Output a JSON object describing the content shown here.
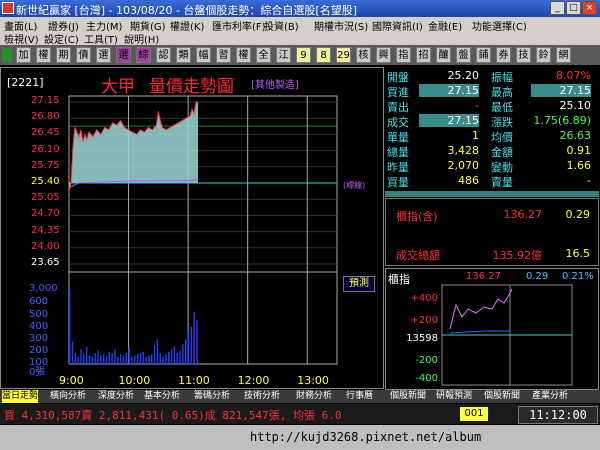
{
  "window": {
    "title": "新世紀贏家 [台灣] - 103/08/20 - 台盤個股走勢：綜合自選股[名望股]",
    "min": "_",
    "max": "□",
    "close": "×"
  },
  "menu": {
    "row1": [
      "畫面(L)",
      "證券(J)",
      "主力(M)",
      "期貨(G)",
      "權證(K)",
      "匯市利率(F)",
      "投資(B)",
      "期權市況(S)",
      "國際資訊(I)",
      "金融(E)",
      "功能選擇(C)"
    ],
    "row2": [
      "檢視(V)",
      "設定(C)",
      "工具(T)",
      "說明(H)"
    ]
  },
  "toolbar": [
    "加",
    "權",
    "期",
    "債",
    "選",
    "選",
    "綜",
    "認",
    "類",
    "幅",
    "習",
    "權",
    "全",
    "江",
    "9",
    "8",
    "29",
    "核",
    "興",
    "指",
    "招",
    "釀",
    "盤",
    "鋪",
    "券",
    "技",
    "鈴",
    "網"
  ],
  "chart": {
    "code": "[2221]",
    "name": "大甲",
    "heading": "量價走勢圖",
    "note": "[其他製造]",
    "price_labels": [
      "27.15",
      "26.80",
      "26.45",
      "26.10",
      "25.75",
      "25.40",
      "25.05",
      "24.70",
      "24.35",
      "24.00",
      "23.65"
    ],
    "volume_labels": [
      "3,000",
      "600",
      "500",
      "400",
      "300",
      "200",
      "100",
      "0張"
    ],
    "time_labels": [
      "9:00",
      "10:00",
      "11:00",
      "12:00",
      "13:00"
    ],
    "flag_label": "(標線)",
    "trial_button": "預測",
    "colors": {
      "price_line": "#ff3030",
      "avg_line": "#c050ff",
      "ref_line": "#40c8c8",
      "volume": "#2040ff",
      "fill": "#9fd8d8"
    }
  },
  "quote": {
    "rows": [
      {
        "l1": "開盤",
        "v1": "25.20",
        "c1": "#ffffff",
        "l2": "振幅",
        "v2": "8.07%",
        "c2": "#ff3030"
      },
      {
        "l1": "買進",
        "v1": "27.15",
        "c1": "#ffffff",
        "hl1": true,
        "l2": "最高",
        "v2": "27.15",
        "c2": "#ffffff",
        "hl2": true
      },
      {
        "l1": "賣出",
        "v1": "-",
        "c1": "#ff3030",
        "l2": "最低",
        "v2": "25.10",
        "c2": "#ffffff"
      },
      {
        "l1": "成交",
        "v1": "27.15",
        "c1": "#ffffff",
        "hl1": true,
        "l2": "漲跌",
        "v2": "1.75(6.89)",
        "c2": "#40ff40"
      },
      {
        "l1": "單量",
        "v1": "1",
        "c1": "#ffff40",
        "l2": "均價",
        "v2": "26.63",
        "c2": "#40ff40"
      },
      {
        "l1": "總量",
        "v1": "3,428",
        "c1": "#ffff40",
        "l2": "金額",
        "v2": "0.91",
        "c2": "#ffff40"
      },
      {
        "l1": "昨量",
        "v1": "2,070",
        "c1": "#ffff40",
        "l2": "變動",
        "v2": "1.66",
        "c2": "#ffff40"
      },
      {
        "l1": "買量",
        "v1": "486",
        "c1": "#ffff40",
        "l2": "賣量",
        "v2": "-",
        "c2": "#ffff40"
      }
    ],
    "index_label": "櫃指(含)",
    "index_value": "136.27",
    "index_change": "0.29",
    "turnover_label": "成交總額",
    "turnover_value": "135.92億",
    "turnover_change": "16.5"
  },
  "mini": {
    "label": "櫃指",
    "value": "136.27",
    "change": "0.29",
    "percent": "0.21%",
    "y_labels": [
      "+400",
      "+200",
      "13598",
      "-200",
      "-400"
    ]
  },
  "tabs": [
    "當日走勢",
    "橫向分析",
    "深度分析",
    "基本分析",
    "籌碼分析",
    "技術分析",
    "財務分析",
    "行事曆",
    "個股新聞",
    "研報預測",
    "個股新聞",
    "產業分析"
  ],
  "status": {
    "ticker": "買 4,310,587賣 2,811,431( 0.65)成 821,547張, 均張 6.0",
    "code_box": "001",
    "clock": "11:12:00"
  },
  "taskbar": {
    "url": "http://kujd3268.pixnet.net/album"
  }
}
